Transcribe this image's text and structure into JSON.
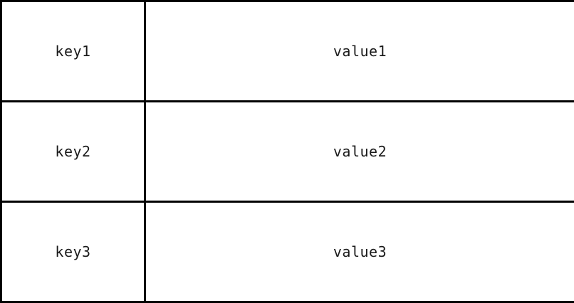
{
  "table": {
    "rows": [
      {
        "key": "key1",
        "value": "value1"
      },
      {
        "key": "key2",
        "value": "value2"
      },
      {
        "key": "key3",
        "value": "value3"
      }
    ]
  },
  "colors": {
    "border": "#000000",
    "text": "#1a1a1a",
    "background": "#ffffff"
  }
}
